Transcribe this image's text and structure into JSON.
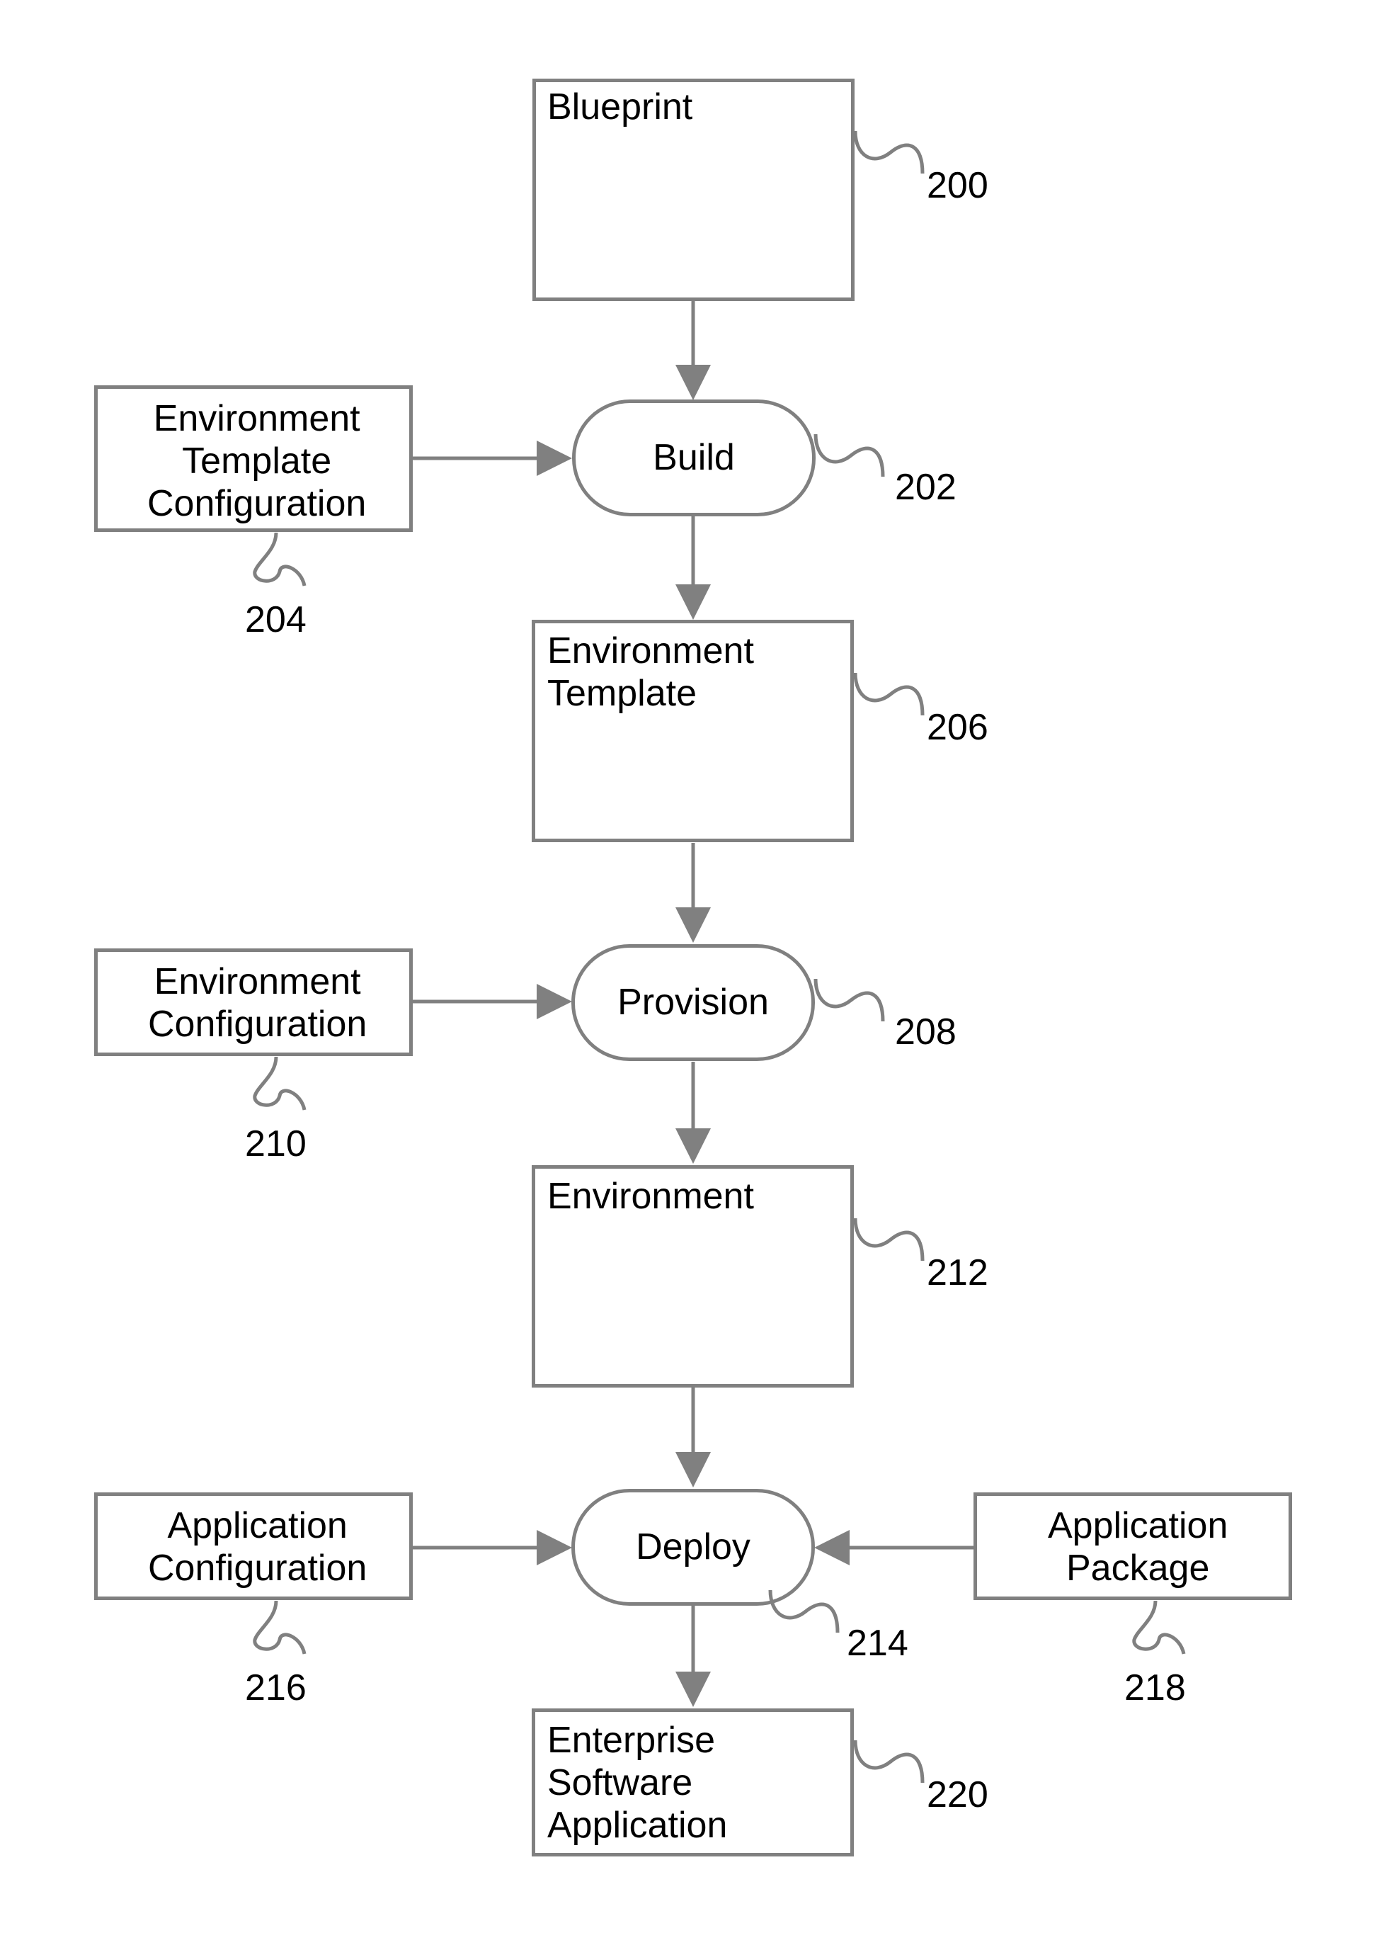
{
  "boxes": {
    "blueprint": {
      "label": "Blueprint",
      "ref": "200"
    },
    "env_template_config": {
      "label": "Environment\nTemplate\nConfiguration",
      "ref": "204"
    },
    "env_template": {
      "label": "Environment\nTemplate",
      "ref": "206"
    },
    "env_config": {
      "label": "Environment\nConfiguration",
      "ref": "210"
    },
    "environment": {
      "label": "Environment",
      "ref": "212"
    },
    "app_config": {
      "label": "Application\nConfiguration",
      "ref": "216"
    },
    "app_package": {
      "label": "Application\nPackage",
      "ref": "218"
    },
    "enterprise_app": {
      "label": "Enterprise\nSoftware\nApplication",
      "ref": "220"
    }
  },
  "pills": {
    "build": {
      "label": "Build",
      "ref": "202"
    },
    "provision": {
      "label": "Provision",
      "ref": "208"
    },
    "deploy": {
      "label": "Deploy",
      "ref": "214"
    }
  }
}
